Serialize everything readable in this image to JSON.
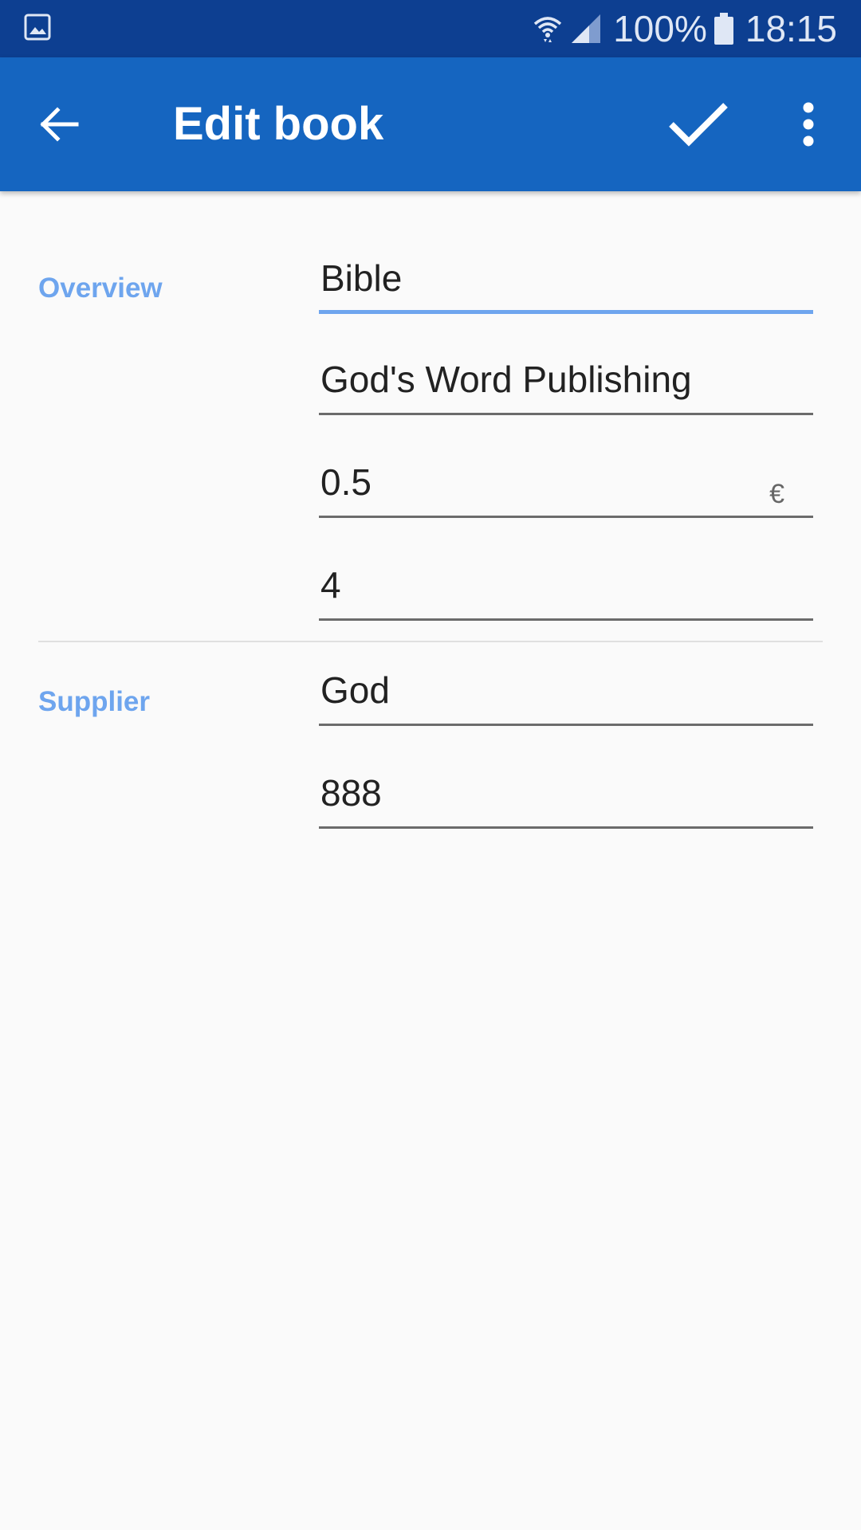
{
  "status_bar": {
    "notification_icon": "gallery-icon",
    "wifi_icon": "wifi-icon",
    "signal_icon": "signal-icon",
    "battery_percent": "100%",
    "battery_icon": "battery-icon",
    "time": "18:15"
  },
  "app_bar": {
    "title": "Edit book",
    "back_icon": "arrow-back-icon",
    "save_icon": "check-icon",
    "more_icon": "more-vert-icon",
    "background_color": "#1565c0"
  },
  "sections": {
    "overview": {
      "label": "Overview",
      "fields": {
        "title": "Bible",
        "publisher": "God's Word Publishing",
        "price": "0.5",
        "price_suffix": "€",
        "quantity": "4"
      }
    },
    "supplier": {
      "label": "Supplier",
      "fields": {
        "name": "God",
        "code": "888"
      }
    }
  },
  "colors": {
    "status_bar": "#0d3f91",
    "accent": "#6ea5ee",
    "background": "#fafafa"
  }
}
